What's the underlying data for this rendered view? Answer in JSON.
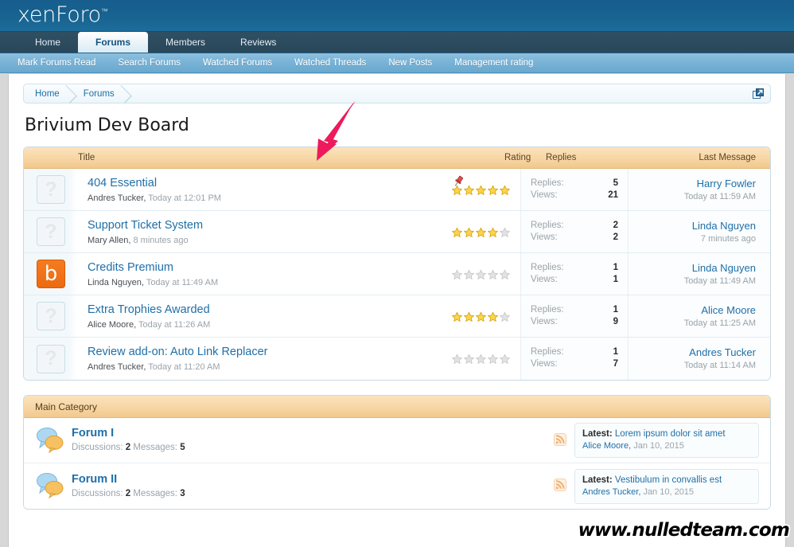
{
  "site": {
    "logo": "xenForo",
    "logo_tm": "™"
  },
  "nav": {
    "tabs": [
      {
        "label": "Home",
        "selected": false
      },
      {
        "label": "Forums",
        "selected": true
      },
      {
        "label": "Members",
        "selected": false
      },
      {
        "label": "Reviews",
        "selected": false
      }
    ],
    "subnav": [
      "Mark Forums Read",
      "Search Forums",
      "Watched Forums",
      "Watched Threads",
      "New Posts",
      "Management rating"
    ]
  },
  "breadcrumb": {
    "items": [
      "Home",
      "Forums"
    ],
    "popup_icon": "open-in-new-window-icon"
  },
  "page": {
    "title": "Brivium Dev Board"
  },
  "thread_list": {
    "columns": {
      "title": "Title",
      "rating": "Rating",
      "replies": "Replies",
      "last_message": "Last Message"
    },
    "labels": {
      "replies": "Replies:",
      "views": "Views:"
    },
    "rows": [
      {
        "avatar": {
          "type": "placeholder",
          "glyph": "?"
        },
        "title": "404 Essential",
        "author": "Andres Tucker,",
        "date": "Today at 12:01 PM",
        "sticky": true,
        "rating": 5,
        "replies": "5",
        "views": "21",
        "last_author": "Harry Fowler",
        "last_date": "Today at 11:59 AM"
      },
      {
        "avatar": {
          "type": "placeholder",
          "glyph": "?"
        },
        "title": "Support Ticket System",
        "author": "Mary Allen,",
        "date": "8 minutes ago",
        "sticky": false,
        "rating": 4,
        "replies": "2",
        "views": "2",
        "last_author": "Linda Nguyen",
        "last_date": "7 minutes ago"
      },
      {
        "avatar": {
          "type": "brand",
          "glyph": "b"
        },
        "title": "Credits Premium",
        "author": "Linda Nguyen,",
        "date": "Today at 11:49 AM",
        "sticky": false,
        "rating": 0,
        "replies": "1",
        "views": "1",
        "last_author": "Linda Nguyen",
        "last_date": "Today at 11:49 AM"
      },
      {
        "avatar": {
          "type": "placeholder",
          "glyph": "?"
        },
        "title": "Extra Trophies Awarded",
        "author": "Alice Moore,",
        "date": "Today at 11:26 AM",
        "sticky": false,
        "rating": 4,
        "replies": "1",
        "views": "9",
        "last_author": "Alice Moore",
        "last_date": "Today at 11:25 AM"
      },
      {
        "avatar": {
          "type": "placeholder",
          "glyph": "?"
        },
        "title": "Review add-on: Auto Link Replacer",
        "author": "Andres Tucker,",
        "date": "Today at 11:20 AM",
        "sticky": false,
        "rating": 0,
        "replies": "1",
        "views": "7",
        "last_author": "Andres Tucker",
        "last_date": "Today at 11:14 AM"
      }
    ]
  },
  "category": {
    "title": "Main Category",
    "forums": [
      {
        "name": "Forum I",
        "discussions_label": "Discussions:",
        "discussions": "2",
        "messages_label": "Messages:",
        "messages": "5",
        "latest_label": "Latest:",
        "latest_title": "Lorem ipsum dolor sit amet",
        "latest_author": "Alice Moore,",
        "latest_date": "Jan 10, 2015"
      },
      {
        "name": "Forum II",
        "discussions_label": "Discussions:",
        "discussions": "2",
        "messages_label": "Messages:",
        "messages": "3",
        "latest_label": "Latest:",
        "latest_title": "Vestibulum in convallis est",
        "latest_author": "Andres Tucker,",
        "latest_date": "Jan 10, 2015"
      }
    ]
  },
  "annotation": {
    "arrow": "red-arrow-pointing-down-left",
    "color": "#ed1a5c"
  },
  "watermark": {
    "text": "www.nulledteam.com"
  },
  "colors": {
    "header_blue": "#17628f",
    "subnav_blue": "#78b2d6",
    "accent_orange": "#f7d6a4",
    "link_blue": "#1f6fa8",
    "brand_orange": "#f57c20",
    "star_gold": "#f5c518",
    "star_gray": "#dcdcdc"
  }
}
